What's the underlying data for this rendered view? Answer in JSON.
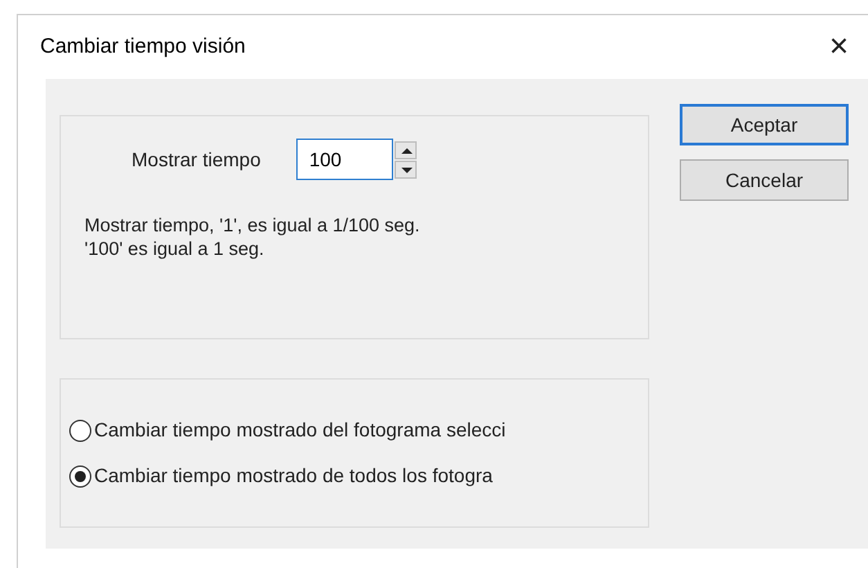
{
  "window": {
    "title": "Cambiar tiempo visión",
    "close": "×"
  },
  "time_field": {
    "label": "Mostrar tiempo",
    "value": "100"
  },
  "info": [
    "Mostrar tiempo, '1', es igual a 1/100 seg.",
    "'100' es igual a 1 seg."
  ],
  "options": [
    {
      "label": "Cambiar tiempo mostrado del fotograma selecci",
      "selected": false
    },
    {
      "label": "Cambiar tiempo mostrado de todos los fotogra",
      "selected": true
    }
  ],
  "buttons": [
    {
      "label": "Aceptar",
      "default": true
    },
    {
      "label": "Cancelar",
      "default": false
    }
  ]
}
